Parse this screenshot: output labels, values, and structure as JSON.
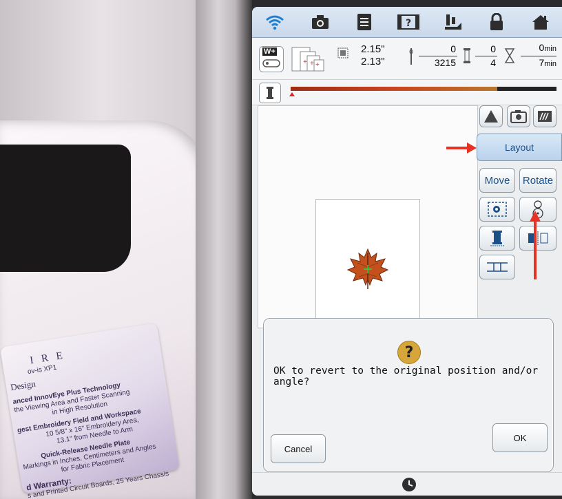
{
  "background_photo": {
    "label_card": {
      "line1": "I R E",
      "line2": "ov-is XP1",
      "line3": "Design",
      "line4": "anced InnovEye Plus Technology",
      "line5": "the Viewing Area and Faster Scanning",
      "line6": "in High Resolution",
      "line7": "gest Embroidery Field and Workspace",
      "line8": "10 5/8\" x 16\" Embroidery Area,",
      "line9": "13.1\" from Needle to Arm",
      "line10": "Quick-Release Needle Plate",
      "line11": "Markings in Inches, Centimeters and Angles",
      "line12": "for Fabric Placement",
      "line13": "d Warranty:",
      "line14": "s and Printed Circuit Boards, 25 Years Chassis"
    }
  },
  "topbar": {
    "icons": [
      "wifi-icon",
      "camera-icon",
      "document-icon",
      "help-icon",
      "presser-foot-icon",
      "lock-icon",
      "home-icon"
    ]
  },
  "status": {
    "wireless_badge": "W+",
    "width": "2.15\"",
    "height": "2.13\"",
    "stitch_current": "0",
    "stitch_total": "3215",
    "color_current": "0",
    "color_total": "4",
    "time_current": "0",
    "time_total": "7",
    "time_unit": "min"
  },
  "panel": {
    "layout_label": "Layout",
    "move_label": "Move",
    "rotate_label": "Rotate"
  },
  "dialog": {
    "icon": "question-icon",
    "icon_glyph": "?",
    "message": "OK to revert to the original position and/or angle?",
    "cancel_label": "Cancel",
    "ok_label": "OK"
  },
  "colors": {
    "accent": "#1b4f86",
    "question_badge": "#d7a63a",
    "annotation_arrow": "#e53224",
    "thread_bar": "#b23a1e"
  }
}
